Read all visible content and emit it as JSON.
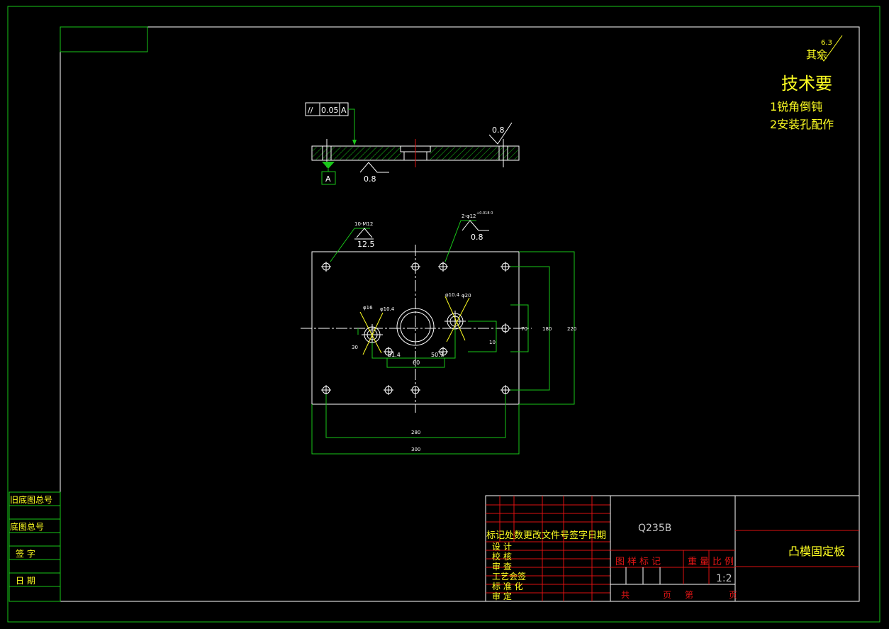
{
  "colors": {
    "background": "#000000",
    "frame": "#19c619",
    "part": "#ffffff",
    "title_grid": "#d11111",
    "text": "#ffff22"
  },
  "surface_finish": {
    "value": "6.3",
    "label": "其余"
  },
  "tech_requirements": {
    "title": "技术要",
    "item_1": "1锐角倒钝",
    "item_2": "2安装孔配作"
  },
  "section_view": {
    "tolerance_symbol": "//",
    "tolerance_value": "0.05",
    "tolerance_datum": "A",
    "datum_label": "A",
    "roughness_bottom": "0.8",
    "roughness_top_right": "0.8"
  },
  "plan_view": {
    "hole_callout_left": "10-M12",
    "roughness_left": "12.5",
    "hole_callout_right": "2-φ12",
    "hole_tolerance": "+0.018 0",
    "roughness_right": "0.8",
    "dia_left_a": "φ16",
    "dia_left_b": "φ10.4",
    "dia_right_a": "φ10.4",
    "dia_right_b": "φ20",
    "dim_left_x": "31.4",
    "dim_right_x": "50.7",
    "dim_center_span": "60",
    "dim_left_v": "30",
    "dim_right_v_small": "10",
    "dim_v_70": "70",
    "dim_v_180": "180",
    "dim_v_220": "220",
    "dim_h_280": "280",
    "dim_h_300": "300"
  },
  "side_labels": [
    "旧底图总号",
    "底图总号",
    "签    字",
    "日    期"
  ],
  "title_block": {
    "material": "Q235B",
    "revision_header": "标记处数更改文件号签字日期",
    "roles": [
      "设    计",
      "校    核",
      "审    查",
      "工艺会签",
      "标 准 化",
      "审    定"
    ],
    "cols_header": "图样标记",
    "weight_label": "重量",
    "scale_label": "比例",
    "scale_value": "1:2",
    "sheets_total": "共",
    "sheet_unit": "页",
    "sheet_no": "第",
    "sheet_unit2": "页",
    "part_name": "凸模固定板"
  }
}
